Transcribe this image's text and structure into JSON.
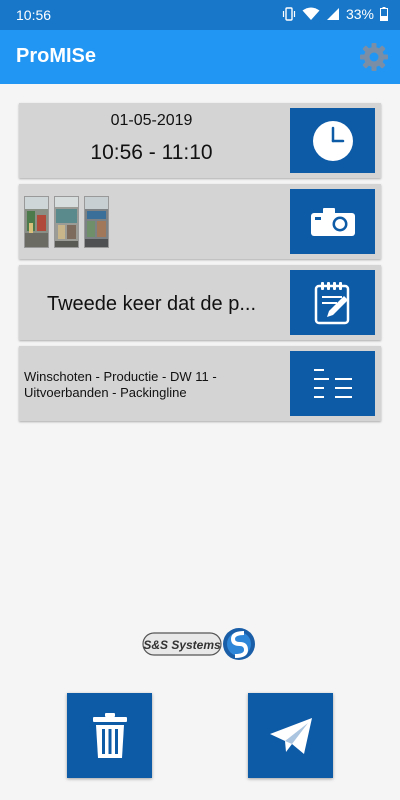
{
  "status": {
    "time": "10:56",
    "battery": "33%"
  },
  "appbar": {
    "title": "ProMISe",
    "settings_icon": "gear-icon"
  },
  "cards": {
    "datetime": {
      "date": "01-05-2019",
      "time_range": "10:56 - 11:10",
      "icon": "clock-icon"
    },
    "photos": {
      "count": 3,
      "icon": "camera-icon"
    },
    "note": {
      "text": "Tweede keer dat de p...",
      "icon": "notepad-icon"
    },
    "location": {
      "line1": "Winschoten - Productie - DW 11 -",
      "line2": "Uitvoerbanden - Packingline",
      "icon": "list-icon"
    }
  },
  "logo": {
    "text": "S&S Systems"
  },
  "actions": {
    "delete_icon": "trash-icon",
    "send_icon": "paper-plane-icon"
  },
  "colors": {
    "statusbar": "#1877c8",
    "appbar": "#2196f3",
    "button": "#0d5aa7",
    "card": "#d4d4d4"
  }
}
